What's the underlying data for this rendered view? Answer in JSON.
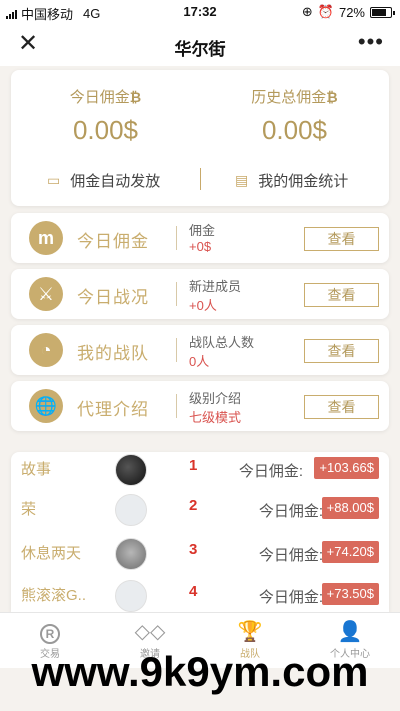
{
  "status": {
    "carrier": "中国移动",
    "network": "4G",
    "time": "17:32",
    "battery": "72%"
  },
  "nav": {
    "close": "✕",
    "title": "华尔街",
    "more": "•••"
  },
  "summary": {
    "today_label": "今日佣金",
    "today_value": "0.00$",
    "total_label": "历史总佣金",
    "total_value": "0.00$",
    "btc_symbol": "₿",
    "auto_label": "佣金自动发放",
    "stats_label": "我的佣金统计"
  },
  "rows": [
    {
      "title": "今日佣金",
      "icon": "m",
      "label": "佣金",
      "value": "+0$",
      "button": "查看"
    },
    {
      "title": "今日战况",
      "icon": "⚔",
      "label": "新进成员",
      "value": "+0人",
      "button": "查看"
    },
    {
      "title": "我的战队",
      "icon": "◔",
      "label": "战队总人数",
      "value": "0人",
      "button": "查看"
    },
    {
      "title": "代理介绍",
      "icon": "🌐",
      "label": "级别介绍",
      "value": "七级模式",
      "button": "查看"
    }
  ],
  "ranking": {
    "amount_label": "今日佣金:",
    "items": [
      {
        "name": "故事",
        "rank": "1",
        "amount": "+103.66$"
      },
      {
        "name": "荣",
        "rank": "2",
        "amount": "+88.00$"
      },
      {
        "name": "休息两天",
        "rank": "3",
        "amount": "+74.20$"
      },
      {
        "name": "熊滚滚G..",
        "rank": "4",
        "amount": "+73.50$"
      }
    ]
  },
  "tabs": [
    {
      "label": "交易",
      "icon": "R"
    },
    {
      "label": "邀请",
      "icon": "◇◇"
    },
    {
      "label": "战队",
      "icon": "🏆"
    },
    {
      "label": "个人中心",
      "icon": "👤"
    }
  ],
  "watermark": "www.9k9ym.com",
  "colors": {
    "accent": "#c9ad6e",
    "red": "#d9342b",
    "badge": "#d96a5c"
  }
}
